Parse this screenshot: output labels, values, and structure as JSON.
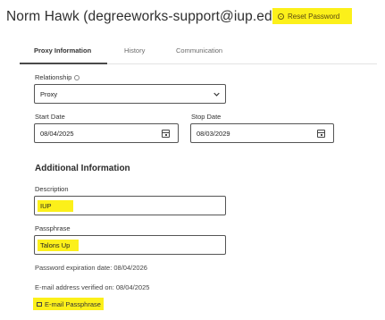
{
  "header": {
    "title": "Norm Hawk (degreeworks-support@iup.edu)",
    "reset_label": "Reset Password"
  },
  "tabs": [
    {
      "label": "Proxy Information",
      "active": true
    },
    {
      "label": "History",
      "active": false
    },
    {
      "label": "Communication",
      "active": false
    }
  ],
  "form": {
    "relationship_label": "Relationship",
    "relationship_value": "Proxy",
    "start_date_label": "Start Date",
    "start_date_value": "08/04/2025",
    "stop_date_label": "Stop Date",
    "stop_date_value": "08/03/2029",
    "additional_title": "Additional Information",
    "description_label": "Description",
    "description_value": "IUP",
    "passphrase_label": "Passphrase",
    "passphrase_value": "Talons Up",
    "password_expiration": "Password expiration date: 08/04/2026",
    "email_verified": "E-mail address verified on: 08/04/2025",
    "email_passphrase_label": "E-mail Passphrase"
  },
  "colors": {
    "highlight": "#fcf01a",
    "text": "#2b2b2b",
    "border": "#555555"
  },
  "icons": [
    "info-icon",
    "chevron-down-icon",
    "calendar-icon",
    "envelope-icon",
    "circle-icon"
  ]
}
